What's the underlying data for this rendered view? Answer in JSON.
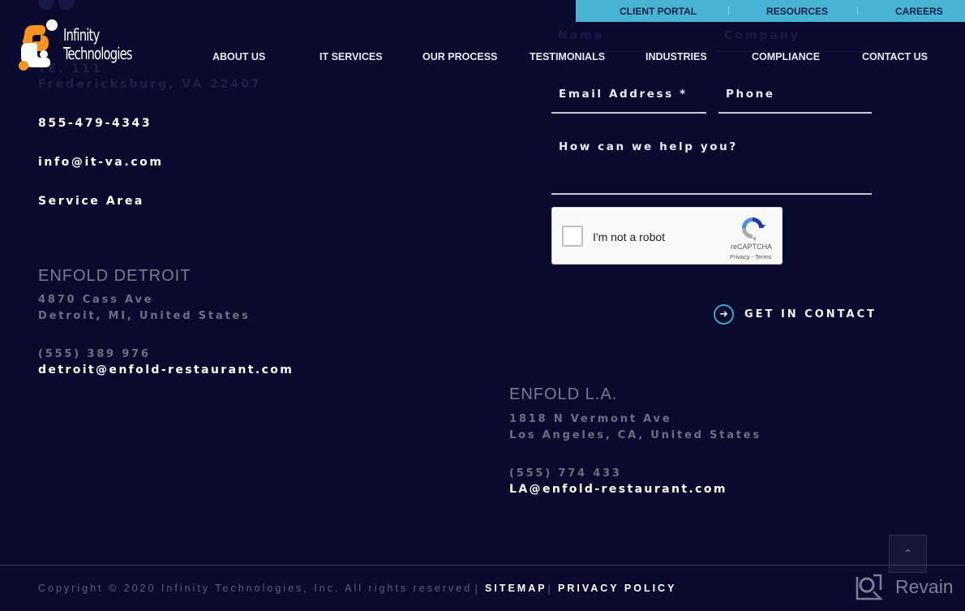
{
  "topbar": {
    "links": [
      "CLIENT PORTAL",
      "RESOURCES",
      "CAREERS"
    ],
    "separator": "|"
  },
  "logo": {
    "line1": "Infinity",
    "line2": "Technologies",
    "colors": {
      "orange": "#f7931e",
      "white": "#ffffff"
    }
  },
  "nav": {
    "items": [
      "ABOUT US",
      "IT SERVICES",
      "OUR PROCESS",
      "TESTIMONIALS",
      "INDUSTRIES",
      "COMPLIANCE",
      "CONTACT US"
    ]
  },
  "ghost_text": {
    "suite": "TE. 111",
    "city": "Fredericksburg, VA 22407",
    "name_field": "Name",
    "company_field": "Company"
  },
  "contact": {
    "phone": "855-479-4343",
    "email": "info@it-va.com",
    "service_area": "Service Area"
  },
  "locations": [
    {
      "title": "ENFOLD DETROIT",
      "address_line1": "4870 Cass Ave",
      "address_line2": "Detroit, MI, United States",
      "phone": "(555) 389 976",
      "email": "detroit@enfold-restaurant.com"
    },
    {
      "title": "ENFOLD L.A.",
      "address_line1": "1818 N Vermont Ave",
      "address_line2": "Los Angeles, CA, United States",
      "phone": "(555) 774 433",
      "email": "LA@enfold-restaurant.com"
    }
  ],
  "form": {
    "email_placeholder": "Email Address *",
    "phone_placeholder": "Phone",
    "message_placeholder": "How can we help you?",
    "captcha": {
      "label": "I'm not a robot",
      "brand": "reCAPTCHA",
      "links": "Privacy - Terms"
    },
    "submit_label": "GET IN CONTACT"
  },
  "footer": {
    "copyright": "Copyright © 2020 Infinity Technologies, Inc. All rights reserved",
    "separator": "|",
    "links": [
      "SITEMAP",
      "PRIVACY POLICY"
    ]
  },
  "scroll_top_icon": "chevron-up-icon",
  "watermark": {
    "text": "Revain"
  },
  "colors": {
    "background": "#0a0a2e",
    "topbar": "#49b3d3",
    "accent": "#3aa3cc",
    "muted_text": "#6e6e82"
  }
}
